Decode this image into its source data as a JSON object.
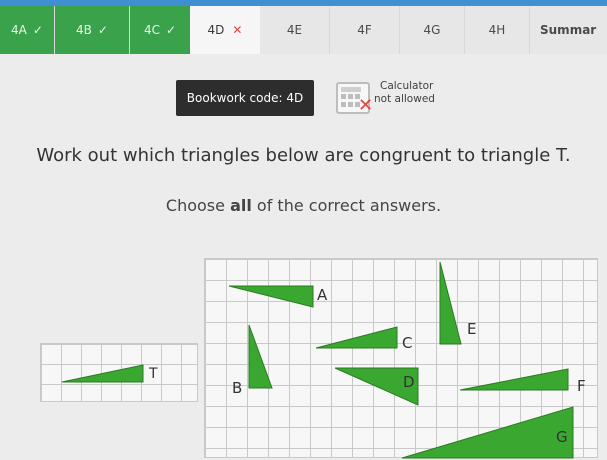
{
  "tabs": [
    {
      "label": "4A",
      "status": "done"
    },
    {
      "label": "4B",
      "status": "done"
    },
    {
      "label": "4C",
      "status": "done"
    },
    {
      "label": "4D",
      "status": "current"
    },
    {
      "label": "4E",
      "status": "none"
    },
    {
      "label": "4F",
      "status": "none"
    },
    {
      "label": "4G",
      "status": "none"
    },
    {
      "label": "4H",
      "status": "none"
    },
    {
      "label": "Summar",
      "status": "summary"
    }
  ],
  "bookwork": {
    "label": "Bookwork code: 4D"
  },
  "calculator": {
    "line1": "Calculator",
    "line2": "not allowed"
  },
  "question": {
    "line1": "Work out which triangles below are congruent to triangle T.",
    "line2_pre": "Choose ",
    "line2_bold": "all",
    "line2_post": " of the correct answers."
  },
  "triangles": {
    "T": "T",
    "A": "A",
    "B": "B",
    "C": "C",
    "D": "D",
    "E": "E",
    "F": "F",
    "G": "G"
  },
  "colors": {
    "accent": "#3aa24a",
    "triangle_fill": "#3aa830",
    "header_blue": "#3f8fd3"
  }
}
